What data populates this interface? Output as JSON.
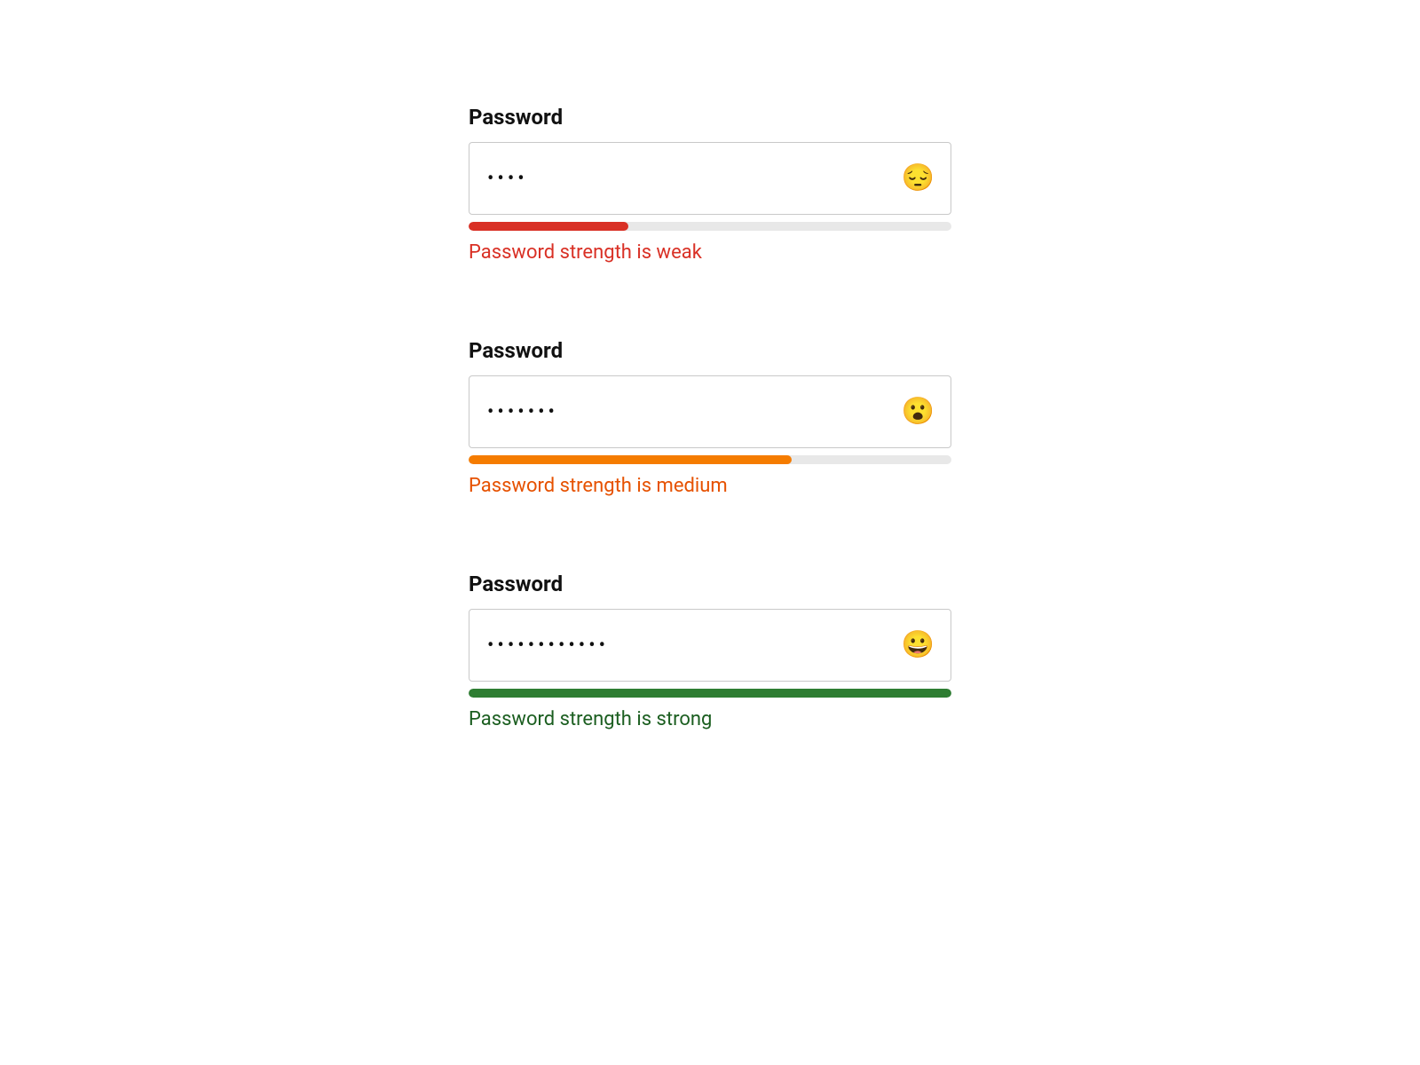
{
  "fields": [
    {
      "label": "Password",
      "value": "abcd",
      "emoji": "😔",
      "emoji_name": "pensive-face-icon",
      "meter_pct": 33,
      "meter_color": "#d93025",
      "caption": "Password strength is weak",
      "caption_color": "#d93025"
    },
    {
      "label": "Password",
      "value": "abcdefg",
      "emoji": "😮",
      "emoji_name": "open-mouth-face-icon",
      "meter_pct": 67,
      "meter_color": "#f57c00",
      "caption": "Password strength is medium",
      "caption_color": "#e65100"
    },
    {
      "label": "Password",
      "value": "abcdefghijkl",
      "emoji": "😀",
      "emoji_name": "grinning-face-icon",
      "meter_pct": 100,
      "meter_color": "#2e7d32",
      "caption": "Password strength is strong",
      "caption_color": "#1b5e20"
    }
  ]
}
